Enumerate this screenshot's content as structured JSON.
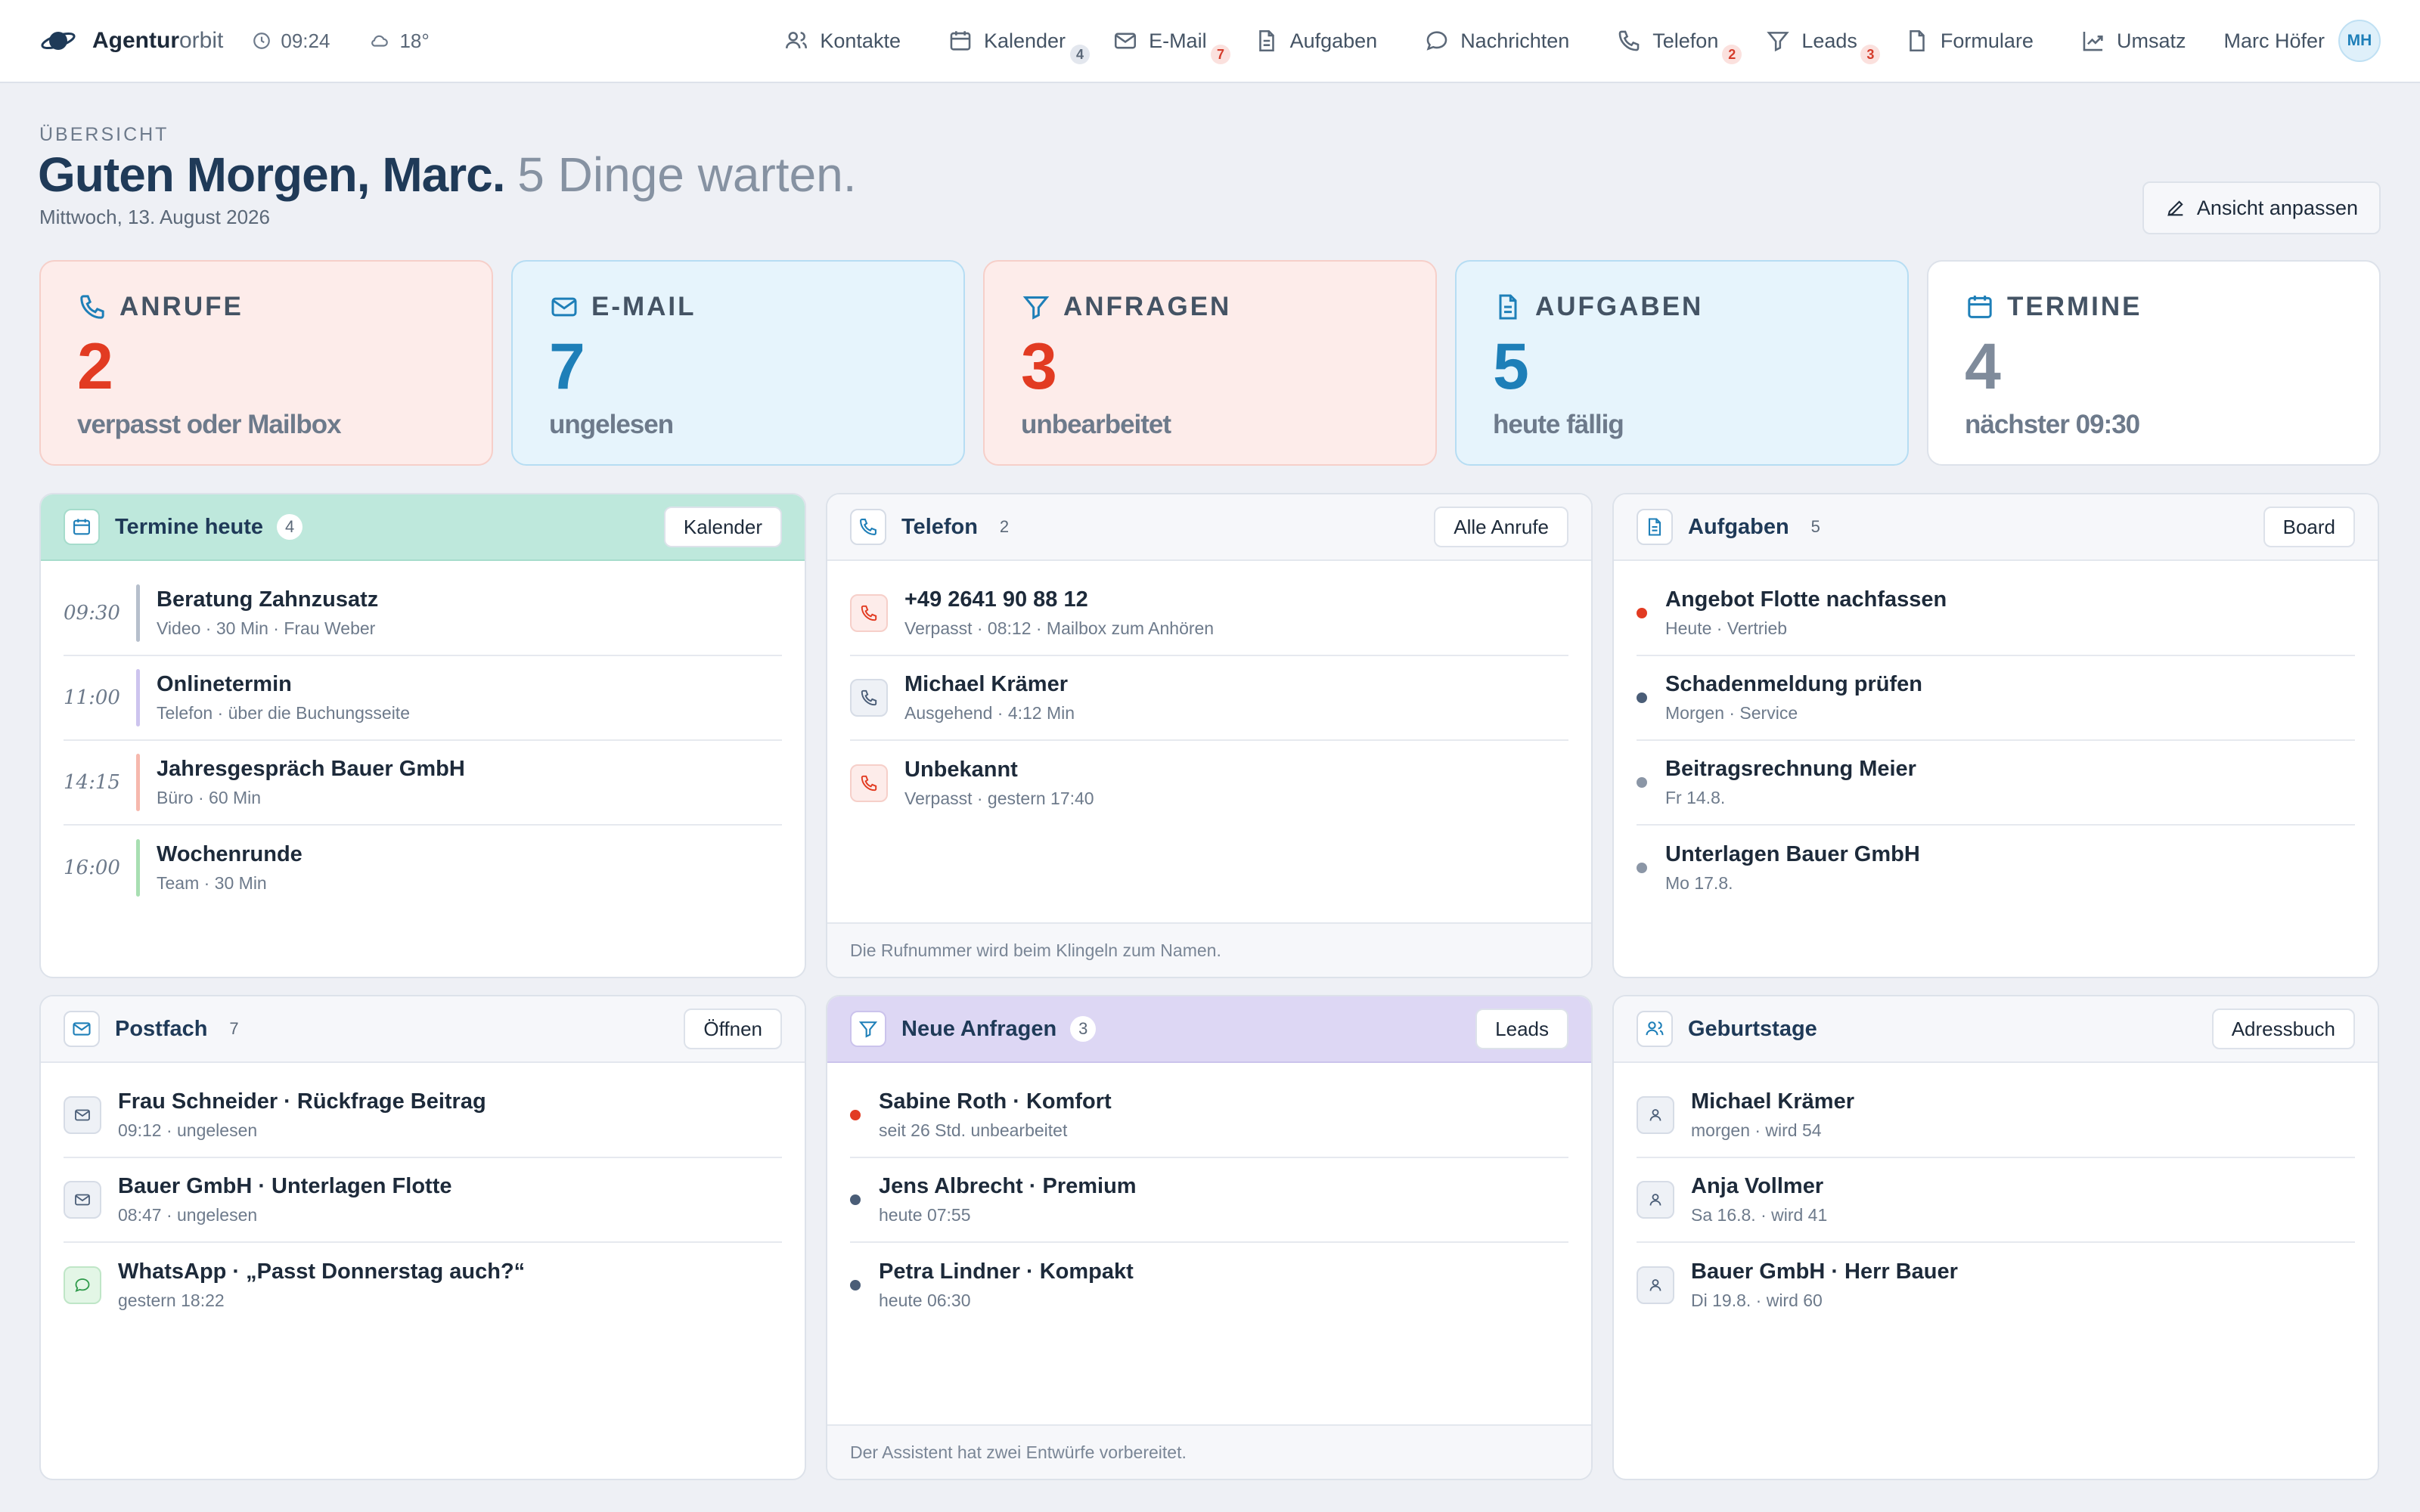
{
  "app": {
    "brand_bold": "Agentur",
    "brand_light": "orbit",
    "time": "09:24",
    "weather": "18°"
  },
  "nav": [
    {
      "label": "Kontakte",
      "icon": "users-icon"
    },
    {
      "label": "Kalender",
      "icon": "calendar-icon",
      "badge": "4"
    },
    {
      "label": "E-Mail",
      "icon": "mail-icon",
      "badge": "7"
    },
    {
      "label": "Aufgaben",
      "icon": "document-icon"
    },
    {
      "label": "Nachrichten",
      "icon": "chat-icon"
    },
    {
      "label": "Telefon",
      "icon": "phone-icon",
      "badge": "2"
    },
    {
      "label": "Leads",
      "icon": "funnel-icon",
      "badge": "3"
    },
    {
      "label": "Formulare",
      "icon": "file-icon"
    },
    {
      "label": "Umsatz",
      "icon": "trend-icon"
    }
  ],
  "user": {
    "name": "Marc Höfer",
    "initials": "MH"
  },
  "header": {
    "eyebrow": "ÜBERSICHT",
    "greeting": "Guten Morgen, Marc.",
    "subline": "5 Dinge warten.",
    "date": "Mittwoch, 13. August 2026",
    "customize": "Ansicht anpassen"
  },
  "stats": [
    {
      "label": "ANRUFE",
      "value": "2",
      "desc": "verpasst oder Mailbox",
      "color": "#e23b22"
    },
    {
      "label": "E-MAIL",
      "value": "7",
      "desc": "ungelesen",
      "color": "#1e7fb8"
    },
    {
      "label": "ANFRAGEN",
      "value": "3",
      "desc": "unbearbeitet",
      "color": "#e23b22"
    },
    {
      "label": "AUFGABEN",
      "value": "5",
      "desc": "heute fällig",
      "color": "#1e7fb8"
    },
    {
      "label": "TERMINE",
      "value": "4",
      "desc": "nächster 09:30",
      "color": "#7f8b9b"
    }
  ],
  "appointments": {
    "title": "Termine heute",
    "count": "4",
    "button": "Kalender",
    "items": [
      {
        "time": "09:30",
        "title": "Beratung Zahnzusatz",
        "meta": "Video · 30 Min · Frau Weber",
        "color": "#b6bfcc"
      },
      {
        "time": "11:00",
        "title": "Onlinetermin",
        "meta": "Telefon · über die Buchungsseite",
        "color": "#cdc4ee"
      },
      {
        "time": "14:15",
        "title": "Jahresgespräch Bauer GmbH",
        "meta": "Büro · 60 Min",
        "color": "#f6b8ad"
      },
      {
        "time": "16:00",
        "title": "Wochenrunde",
        "meta": "Team · 30 Min",
        "color": "#a8dfb2"
      }
    ]
  },
  "phone": {
    "title": "Telefon",
    "count": "2",
    "button": "Alle Anrufe",
    "items": [
      {
        "title": "+49 2641 90 88 12",
        "meta": "Verpasst · 08:12 · Mailbox zum Anhören",
        "kind": "missed"
      },
      {
        "title": "Michael Krämer",
        "meta": "Ausgehend · 4:12 Min",
        "kind": "outgoing"
      },
      {
        "title": "Unbekannt",
        "meta": "Verpasst · gestern 17:40",
        "kind": "missed"
      }
    ],
    "footer": "Die Rufnummer wird beim Klingeln zum Namen."
  },
  "tasks": {
    "title": "Aufgaben",
    "count": "5",
    "button": "Board",
    "items": [
      {
        "title": "Angebot Flotte nachfassen",
        "meta": "Heute · Vertrieb",
        "color": "#e23b22"
      },
      {
        "title": "Schadenmeldung prüfen",
        "meta": "Morgen · Service",
        "color": "#4a5d77"
      },
      {
        "title": "Beitragsrechnung Meier",
        "meta": "Fr 14.8.",
        "color": "#8b96a6"
      },
      {
        "title": "Unterlagen Bauer GmbH",
        "meta": "Mo 17.8.",
        "color": "#8b96a6"
      }
    ]
  },
  "inbox": {
    "title": "Postfach",
    "count": "7",
    "button": "Öffnen",
    "items": [
      {
        "title": "Frau Schneider · Rückfrage Beitrag",
        "meta": "09:12 · ungelesen",
        "kind": "mail"
      },
      {
        "title": "Bauer GmbH · Unterlagen Flotte",
        "meta": "08:47 · ungelesen",
        "kind": "mail"
      },
      {
        "title": "WhatsApp · „Passt Donnerstag auch?“",
        "meta": "gestern 18:22",
        "kind": "whatsapp"
      }
    ]
  },
  "leads": {
    "title": "Neue Anfragen",
    "count": "3",
    "button": "Leads",
    "items": [
      {
        "title": "Sabine Roth · Komfort",
        "meta": "seit 26 Std. unbearbeitet",
        "color": "#e23b22"
      },
      {
        "title": "Jens Albrecht · Premium",
        "meta": "heute 07:55",
        "color": "#4a5d77"
      },
      {
        "title": "Petra Lindner · Kompakt",
        "meta": "heute 06:30",
        "color": "#4a5d77"
      }
    ],
    "footer": "Der Assistent hat zwei Entwürfe vorbereitet."
  },
  "birthdays": {
    "title": "Geburtstage",
    "button": "Adressbuch",
    "items": [
      {
        "title": "Michael Krämer",
        "meta": "morgen · wird 54"
      },
      {
        "title": "Anja Vollmer",
        "meta": "Sa 16.8. · wird 41"
      },
      {
        "title": "Bauer GmbH · Herr Bauer",
        "meta": "Di 19.8. · wird 60"
      }
    ]
  }
}
